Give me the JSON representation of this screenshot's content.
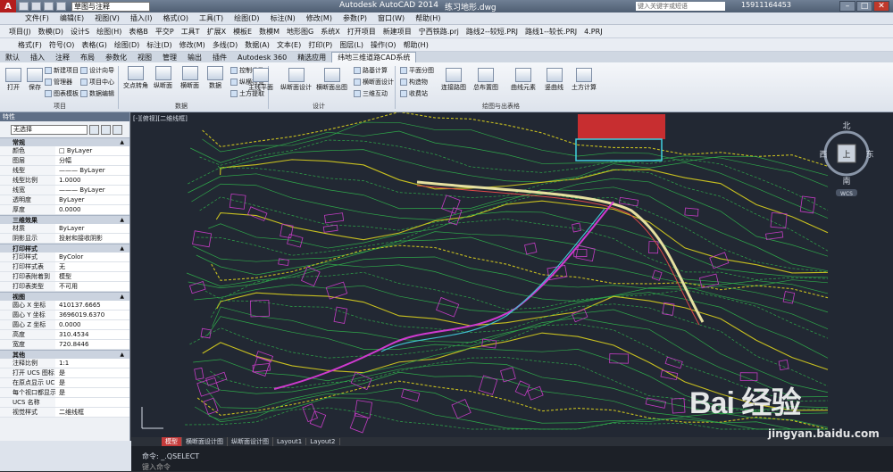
{
  "titlebar": {
    "logo": "A",
    "workspace": "草图与注释",
    "app_title": "Autodesk AutoCAD 2014",
    "doc_title": "练习地形.dwg",
    "search_placeholder": "键入关键字或短语",
    "user": "15911164453",
    "min": "–",
    "max": "□",
    "close": "✕"
  },
  "menubar": [
    "文件(F)",
    "编辑(E)",
    "视图(V)",
    "插入(I)",
    "格式(O)",
    "工具(T)",
    "绘图(D)",
    "标注(N)",
    "修改(M)",
    "参数(P)",
    "窗口(W)",
    "帮助(H)"
  ],
  "toolbar1": [
    "项目(J)",
    "数模(D)",
    "设计S",
    "绘图(H)",
    "表格B",
    "平交P",
    "工具T",
    "扩展X",
    "模板E",
    "数模M",
    "地形图G",
    "系统X",
    "打开项目",
    "新建项目",
    "宁西铁路.prj",
    "路线2--较短.PRJ",
    "路线1--较长.PRJ",
    "4.PRJ"
  ],
  "toolbar2": [
    "格式(F)",
    "符号(O)",
    "表格(G)",
    "绘图(D)",
    "标注(D)",
    "修改(M)",
    "多线(D)",
    "数据(A)",
    "文本(E)",
    "打印(P)",
    "图层(L)",
    "操作(O)",
    "帮助(H)"
  ],
  "ribbon_tabs": [
    "默认",
    "插入",
    "注释",
    "布局",
    "参数化",
    "视图",
    "管理",
    "输出",
    "插件",
    "Autodesk 360",
    "精选应用",
    "纬地三维道路CAD系统"
  ],
  "ribbon": {
    "open": "打开",
    "save": "保存",
    "new_project": "新建项目",
    "manager": "管理器",
    "chart_template": "图表模板",
    "design_wizard": "设计向导",
    "project_center": "项目中心",
    "data_edit": "数据编辑",
    "cross_slope": "交点转角",
    "vertical": "纵断面",
    "cross_section": "横断面",
    "data": "数据",
    "control_params": "控制参数",
    "vert_check": "纵横检查",
    "earthwork": "土方提取",
    "main_plan": "主线平面",
    "vert_design": "纵断面设计",
    "cross_draw": "横断面出图",
    "road_calc": "路基计算",
    "cross_design": "横断面设计",
    "three_in_one": "三维互动",
    "plan_subdiv": "平面分图",
    "structures": "构造物",
    "collection": "收费站",
    "connect_map": "连接路图",
    "total_map": "总布置图",
    "curve_elem": "曲线元素",
    "vert_line": "竖曲线",
    "earthwork_calc": "土方计算",
    "panel_project": "项目",
    "panel_data": "数据",
    "panel_design": "设计",
    "panel_draw": "绘图与出表格"
  },
  "properties": {
    "title": "特性",
    "selection": "无选择",
    "sections": [
      {
        "name": "常规",
        "rows": [
          [
            "颜色",
            "□ ByLayer"
          ],
          [
            "图层",
            "分幅"
          ],
          [
            "线型",
            "——— ByLayer"
          ],
          [
            "线型比例",
            "1.0000"
          ],
          [
            "线宽",
            "——— ByLayer"
          ],
          [
            "透明度",
            "ByLayer"
          ],
          [
            "厚度",
            "0.0000"
          ]
        ]
      },
      {
        "name": "三维效果",
        "rows": [
          [
            "材质",
            "ByLayer"
          ],
          [
            "阴影显示",
            "投射和接收阴影"
          ]
        ]
      },
      {
        "name": "打印样式",
        "rows": [
          [
            "打印样式",
            "ByColor"
          ],
          [
            "打印样式表",
            "无"
          ],
          [
            "打印表附着到",
            "模型"
          ],
          [
            "打印表类型",
            "不可用"
          ]
        ]
      },
      {
        "name": "视图",
        "rows": [
          [
            "圆心 X 坐标",
            "410137.6665"
          ],
          [
            "圆心 Y 坐标",
            "3696019.6370"
          ],
          [
            "圆心 Z 坐标",
            "0.0000"
          ],
          [
            "高度",
            "310.4534"
          ],
          [
            "宽度",
            "720.8446"
          ]
        ]
      },
      {
        "name": "其他",
        "rows": [
          [
            "注释比例",
            "1:1"
          ],
          [
            "打开 UCS 图标",
            "是"
          ],
          [
            "在原点显示 UC...",
            "是"
          ],
          [
            "每个视口都显示...",
            "是"
          ],
          [
            "UCS 名称",
            ""
          ],
          [
            "视觉样式",
            "二维线框"
          ]
        ]
      }
    ]
  },
  "canvas": {
    "view_label": "[-][俯视][二维线框]",
    "compass": {
      "north": "北",
      "south": "南",
      "east": "东",
      "west": "西",
      "top": "上",
      "wcs": "WCS"
    }
  },
  "layout_tabs": [
    "模型",
    "横断面设计图",
    "纵断面设计图",
    "Layout1",
    "Layout2"
  ],
  "command": {
    "last": "命令: _.QSELECT",
    "prompt": "键入命令"
  },
  "watermark": {
    "brand": "Bai 经验",
    "site": "jingyan.baidu.com"
  }
}
